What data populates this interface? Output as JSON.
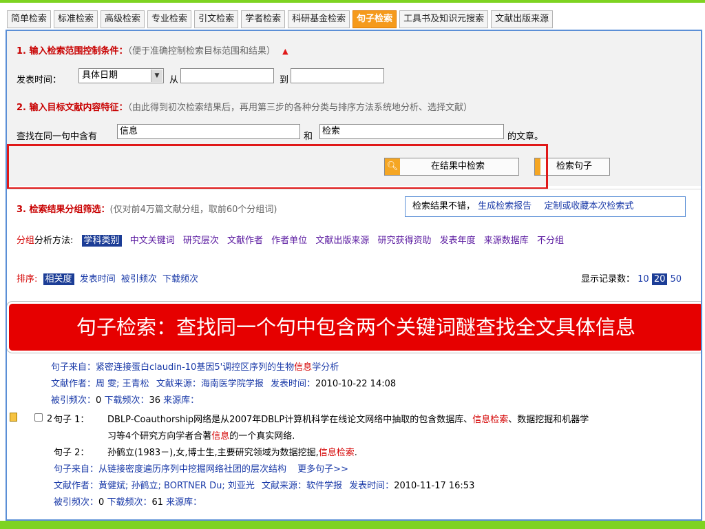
{
  "tabs": [
    {
      "label": "简单检索",
      "active": false
    },
    {
      "label": "标准检索",
      "active": false
    },
    {
      "label": "高级检索",
      "active": false
    },
    {
      "label": "专业检索",
      "active": false
    },
    {
      "label": "引文检索",
      "active": false
    },
    {
      "label": "学者检索",
      "active": false
    },
    {
      "label": "科研基金检索",
      "active": false
    },
    {
      "label": "句子检索",
      "active": true
    },
    {
      "label": "工具书及知识元搜索",
      "active": false
    },
    {
      "label": "文献出版来源",
      "active": false
    }
  ],
  "step1": {
    "title": "1. 输入检索范围控制条件：",
    "hint": "（便于准确控制检索目标范围和结果）"
  },
  "date": {
    "label": "发表时间：",
    "mode": "具体日期",
    "from_label": "从",
    "to_label": "到",
    "from_value": "",
    "to_value": ""
  },
  "step2": {
    "title": "2. 输入目标文献内容特征：",
    "hint": "（由此得到初次检索结果后，再用第三步的各种分类与排序方法系统地分析、选择文献）"
  },
  "sentence": {
    "prefix": "查找在同一句中含有",
    "keyword1": "信息",
    "and_label": "和",
    "keyword2": "检索",
    "suffix": "的文章。"
  },
  "buttons": {
    "search_in_results": "在结果中检索",
    "search_sentence": "检索句子"
  },
  "step3": {
    "title": "3. 检索结果分组筛选：",
    "hint": "(仅对前4万篇文献分组，取前60个分组词)"
  },
  "report": {
    "prefix": "检索结果不错，",
    "generate": "生成检索报告",
    "customize": "定制或收藏本次检索式"
  },
  "grouping": {
    "label_red": "分组",
    "label": "分析方法:",
    "options": [
      "学科类别",
      "中文关键词",
      "研究层次",
      "文献作者",
      "作者单位",
      "文献出版来源",
      "研究获得资助",
      "发表年度",
      "来源数据库",
      "不分组"
    ]
  },
  "sort": {
    "label": "排序:",
    "options": [
      "相关度",
      "发表时间",
      "被引频次",
      "下载频次"
    ],
    "display_label": "显示记录数：",
    "counts": [
      "10",
      "20",
      "50"
    ]
  },
  "callout": "句子检索：查找同一个句中包含两个关键词醚查找全文具体信息",
  "results": [
    {
      "source_label": "句子来自：",
      "source_title_pre": "紧密连接蛋白claudin-10基因5'调控区序列的生物",
      "source_title_hit": "信息",
      "source_title_post": "学分析",
      "authors_label": "文献作者：",
      "authors": "周 雯; 王青松",
      "journal_label": "文献来源：",
      "journal": "海南医学院学报",
      "time_label": "发表时间：",
      "time": "2010-10-22 14:08",
      "cited_label": "被引频次：",
      "cited": "0",
      "downloads_label": "下载频次：",
      "downloads": "36",
      "db_label": "来源库：",
      "db": ""
    },
    {
      "index": "2",
      "s1_label": "句子 1：",
      "s1_line1_pre": "DBLP-Coauthorship网络是从2007年DBLP计算机科学在线论文网络中抽取的包含数据库、",
      "s1_line1_hit": "信息检索",
      "s1_line1_post": "、数据挖掘和机器学",
      "s1_line2_pre": "习等4个研究方向学者合著",
      "s1_line2_hit": "信息",
      "s1_line2_post": "的一个真实网络.",
      "s2_label": "句子 2：",
      "s2_pre": "孙鹤立(1983－),女,博士生,主要研究领域为数据挖掘,",
      "s2_hit": "信息检索",
      "s2_post": ".",
      "source_label": "句子来自：",
      "source_title": "从链接密度遍历序列中挖掘网络社团的层次结构",
      "more": "更多句子>>",
      "authors_label": "文献作者：",
      "authors": "黄健斌; 孙鹤立; BORTNER Du; 刘亚光",
      "journal_label": "文献来源：",
      "journal": "软件学报",
      "time_label": "发表时间：",
      "time": "2010-11-17 16:53",
      "cited_label": "被引频次：",
      "cited": "0",
      "downloads_label": "下载频次：",
      "downloads": "61",
      "db_label": "来源库：",
      "db": ""
    }
  ]
}
